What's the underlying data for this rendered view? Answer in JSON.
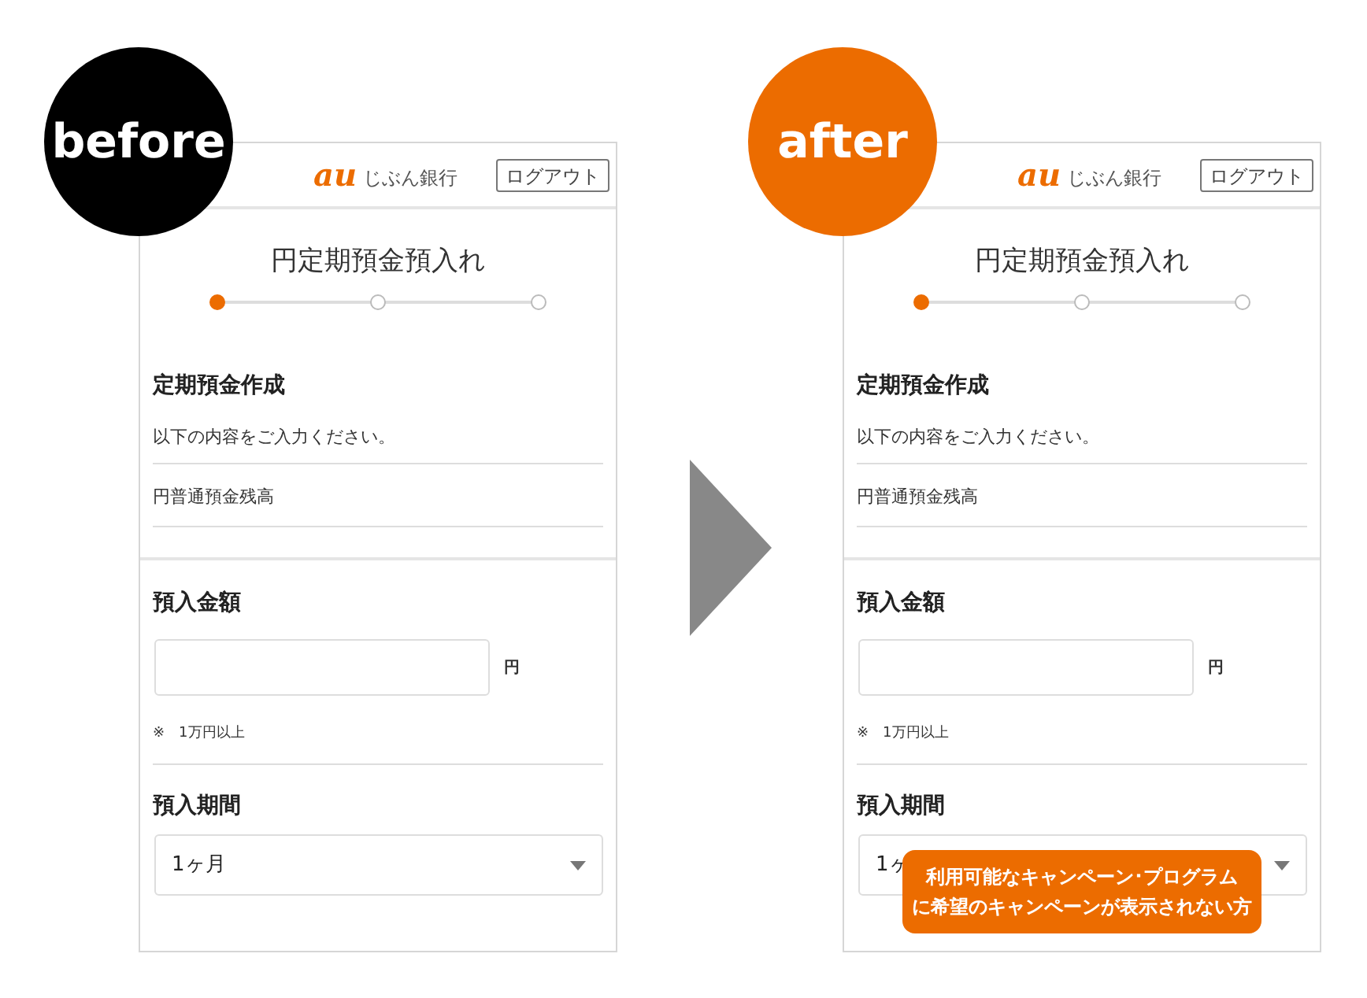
{
  "panels": [
    {
      "badge": "before",
      "logo": {
        "mark": "au",
        "name": "じぶん銀行"
      },
      "logout": "ログアウト",
      "title": "円定期預金預入れ",
      "steps": [
        {
          "selected": true
        },
        {
          "selected": false
        },
        {
          "selected": false
        }
      ],
      "section": "定期預金作成",
      "instruction": "以下の内容をご入力ください。",
      "balance_label": "円普通預金残高",
      "amount": {
        "label": "預入金額",
        "unit": "円",
        "note": "※　1万円以上"
      },
      "period": {
        "label": "預入期間",
        "value": "1ヶ月"
      }
    },
    {
      "badge": "after",
      "logo": {
        "mark": "au",
        "name": "じぶん銀行"
      },
      "logout": "ログアウト",
      "title": "円定期預金預入れ",
      "steps": [
        {
          "selected": true
        },
        {
          "selected": false
        },
        {
          "selected": false
        }
      ],
      "section": "定期預金作成",
      "instruction": "以下の内容をご入力ください。",
      "balance_label": "円普通預金残高",
      "amount": {
        "label": "預入金額",
        "unit": "円",
        "note": "※　1万円以上"
      },
      "period": {
        "label": "預入期間",
        "value": "1ヶ"
      },
      "tooltip": [
        "利用可能なキャンペーン･プログラム",
        "に希望のキャンペーンが表示されない方"
      ]
    }
  ]
}
